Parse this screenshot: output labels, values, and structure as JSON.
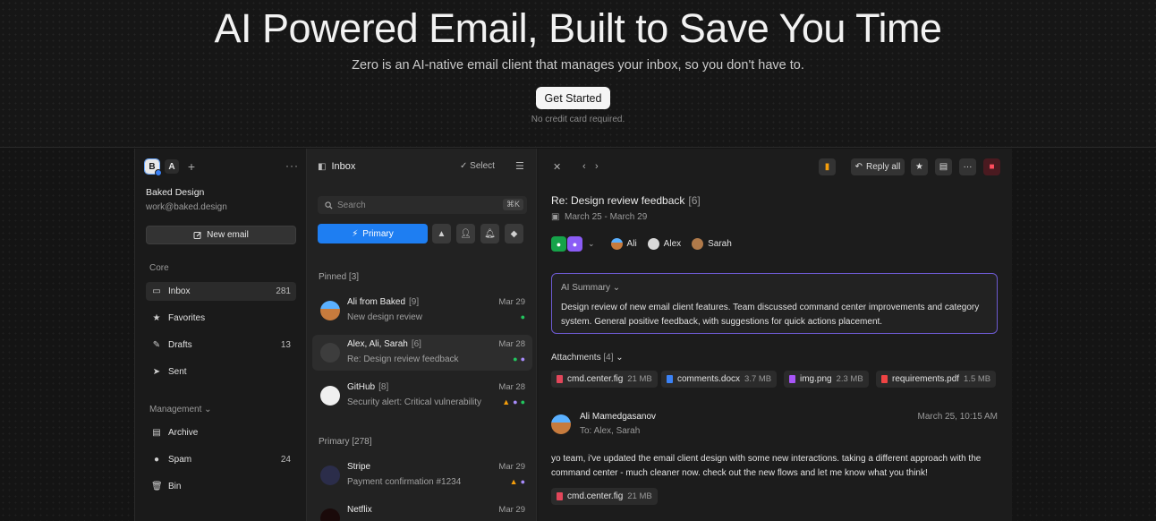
{
  "hero": {
    "title": "AI Powered Email, Built to Save You Time",
    "subtitle": "Zero is an AI-native email client that manages your inbox, so you don't have to.",
    "cta": "Get Started",
    "note": "No credit card required."
  },
  "sidebar": {
    "accounts": [
      "B",
      "A"
    ],
    "add_symbol": "+",
    "more_symbol": "···",
    "account_name": "Baked Design",
    "account_email": "work@baked.design",
    "new_email": "New email",
    "core_label": "Core",
    "core_items": [
      {
        "label": "Inbox",
        "count": "281",
        "icon": "inbox-icon"
      },
      {
        "label": "Favorites",
        "count": "",
        "icon": "star-icon"
      },
      {
        "label": "Drafts",
        "count": "13",
        "icon": "pencil-icon"
      },
      {
        "label": "Sent",
        "count": "",
        "icon": "send-icon"
      }
    ],
    "management_label": "Management",
    "management_items": [
      {
        "label": "Archive",
        "count": "",
        "icon": "archive-icon"
      },
      {
        "label": "Spam",
        "count": "24",
        "icon": "spam-icon"
      },
      {
        "label": "Bin",
        "count": "",
        "icon": "trash-icon"
      }
    ]
  },
  "list": {
    "title": "Inbox",
    "select": "Select",
    "search_placeholder": "Search",
    "shortcut": "⌘K",
    "primary": "Primary",
    "pinned_label": "Pinned",
    "pinned_count": "[3]",
    "primary_label": "Primary",
    "primary_count": "[278]",
    "mails": [
      {
        "from": "Ali from Baked",
        "count": "[9]",
        "subject": "New design review",
        "date": "Mar 29"
      },
      {
        "from": "Alex, Ali, Sarah",
        "count": "[6]",
        "subject": "Re: Design review feedback",
        "date": "Mar 28"
      },
      {
        "from": "GitHub",
        "count": "[8]",
        "subject": "Security alert: Critical vulnerability",
        "date": "Mar 28"
      },
      {
        "from": "Stripe",
        "count": "",
        "subject": "Payment confirmation #1234",
        "date": "Mar 29"
      },
      {
        "from": "Netflix",
        "count": "",
        "subject": "",
        "date": "Mar 29"
      }
    ]
  },
  "pane": {
    "reply_all": "Reply all",
    "subject": "Re: Design review feedback",
    "subject_count": "[6]",
    "dates": "March 25 - March 29",
    "people": [
      "Ali",
      "Alex",
      "Sarah"
    ],
    "summary_label": "AI Summary",
    "summary_text": "Design review of new email client features. Team discussed command center improvements and category system. General positive feedback, with suggestions for quick actions placement.",
    "attachments_label": "Attachments",
    "attachments_count": "[4]",
    "attachments": [
      {
        "name": "cmd.center.fig",
        "size": "21 MB",
        "color": "#e2465a"
      },
      {
        "name": "comments.docx",
        "size": "3.7 MB",
        "color": "#3b82f6"
      },
      {
        "name": "img.png",
        "size": "2.3 MB",
        "color": "#a855f7"
      },
      {
        "name": "requirements.pdf",
        "size": "1.5 MB",
        "color": "#ef4444"
      }
    ],
    "sender": "Ali Mamedgasanov",
    "to": "To: Alex, Sarah",
    "time": "March 25, 10:15 AM",
    "body": "yo team, i've updated the email client design with some new interactions. taking a different approach with the command center - much cleaner now. check out the new flows and let me know what you think!",
    "body_attachment": {
      "name": "cmd.center.fig",
      "size": "21 MB"
    }
  },
  "colors": {
    "accent": "#1e7ef2",
    "summary_border": "#6d5ad1",
    "danger": "#d9263b",
    "pin": "#f59e0b"
  }
}
